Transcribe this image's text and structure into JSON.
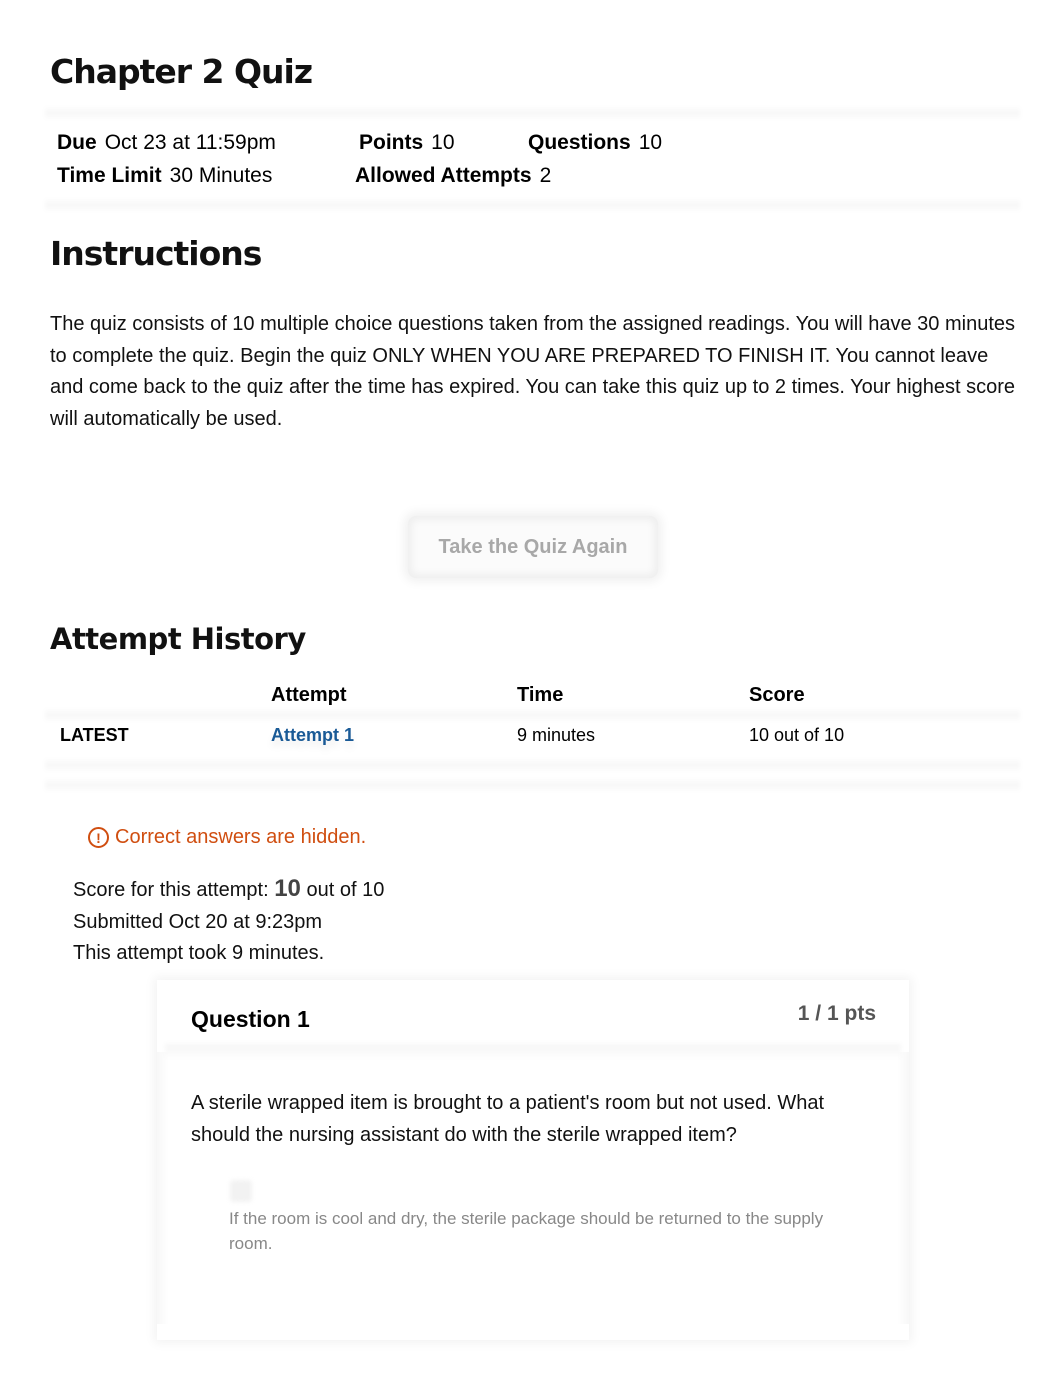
{
  "page": {
    "title": "Chapter 2 Quiz"
  },
  "quiz_meta": {
    "due_label": "Due",
    "due_value": "Oct 23 at 11:59pm",
    "points_label": "Points",
    "points_value": "10",
    "questions_label": "Questions",
    "questions_value": "10",
    "time_limit_label": "Time Limit",
    "time_limit_value": "30 Minutes",
    "allowed_attempts_label": "Allowed Attempts",
    "allowed_attempts_value": "2"
  },
  "instructions": {
    "title": "Instructions",
    "body": "The quiz consists of 10 multiple choice questions taken from the assigned readings. You will have 30 minutes to complete the quiz. Begin the quiz ONLY WHEN YOU ARE PREPARED TO FINISH IT. You cannot leave and come back to the quiz after the time has expired. You can take this quiz up to 2 times. Your highest score will automatically be used."
  },
  "actions": {
    "take_again_label": "Take the Quiz Again"
  },
  "attempt_history": {
    "title": "Attempt History",
    "columns": [
      "",
      "Attempt",
      "Time",
      "Score"
    ],
    "rows": [
      {
        "status": "LATEST",
        "attempt": "Attempt 1",
        "time": "9 minutes",
        "score": "10 out of 10"
      }
    ]
  },
  "attempt_summary": {
    "notice": "Correct answers are hidden.",
    "score_prefix": "Score for this attempt:",
    "score_value": "10",
    "score_suffix": "out of 10",
    "submitted": "Submitted Oct 20 at 9:23pm",
    "duration": "This attempt took 9 minutes."
  },
  "questions": [
    {
      "title": "Question 1",
      "points": "1 / 1 pts",
      "text": "A sterile wrapped item is brought to a patient's room but not used. What should the nursing assistant do with the sterile wrapped item?",
      "answers": [
        {
          "text": "If the room is cool and dry, the sterile package should be returned to the supply room."
        }
      ]
    }
  ],
  "colors": {
    "link": "#1a5a96",
    "warning": "#d04e10",
    "disabled_text": "#a8a8a8"
  }
}
